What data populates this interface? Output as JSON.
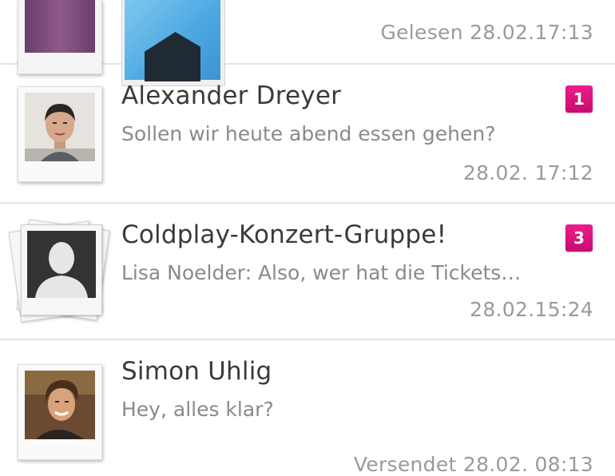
{
  "conversations": [
    {
      "status_time": "Gelesen 28.02.17:13"
    },
    {
      "name": "Alexander Dreyer",
      "preview": "Sollen wir heute abend essen gehen?",
      "time": "28.02. 17:12",
      "badge": "1",
      "avatar_icon": "person-photo"
    },
    {
      "name": "Coldplay-Konzert-Gruppe!",
      "preview": "Lisa Noelder: Also, wer hat die Tickets…",
      "time": "28.02.15:24",
      "badge": "3",
      "avatar_icon": "group-silhouette-icon"
    },
    {
      "name": "Simon Uhlig",
      "preview": "Hey, alles klar?",
      "time": "Versendet 28.02. 08:13",
      "avatar_icon": "person-photo"
    }
  ],
  "colors": {
    "badge": "#d6107c",
    "name_text": "#3a3a3a",
    "secondary_text": "#8a8a8a",
    "divider": "#e4e4e4"
  }
}
